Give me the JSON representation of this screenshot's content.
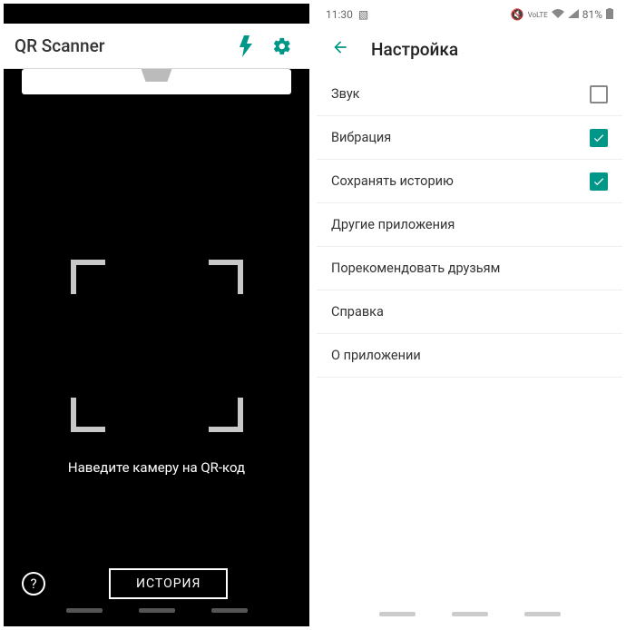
{
  "left": {
    "app_title": "QR Scanner",
    "hint": "Наведите камеру на QR-код",
    "history_button": "ИСТОРИЯ",
    "help_icon": "?"
  },
  "right": {
    "status": {
      "time": "11:30",
      "battery": "81%"
    },
    "title": "Настройка",
    "items": [
      {
        "label": "Звук",
        "checkbox": true,
        "checked": false
      },
      {
        "label": "Вибрация",
        "checkbox": true,
        "checked": true
      },
      {
        "label": "Сохранять историю",
        "checkbox": true,
        "checked": true
      },
      {
        "label": "Другие приложения",
        "checkbox": false
      },
      {
        "label": "Порекомендовать друзьям",
        "checkbox": false
      },
      {
        "label": "Справка",
        "checkbox": false
      },
      {
        "label": "О приложении",
        "checkbox": false
      }
    ]
  },
  "colors": {
    "accent": "#009688"
  }
}
